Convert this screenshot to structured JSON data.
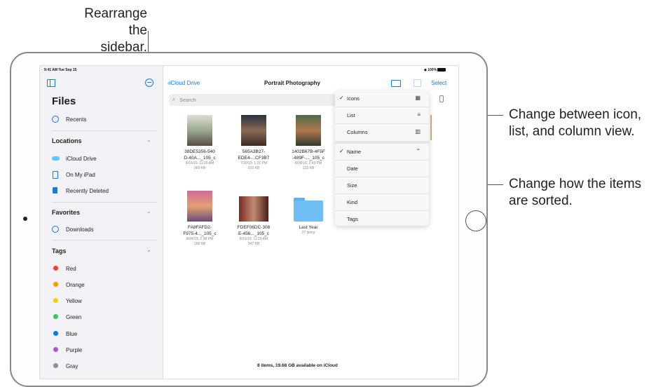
{
  "callouts": {
    "sidebar_line1": "Rearrange the",
    "sidebar_line2": "sidebar.",
    "view_line1": "Change between icon,",
    "view_line2": "list, and column view.",
    "sort_line1": "Change how the items",
    "sort_line2": "are sorted."
  },
  "status": {
    "time": "9:41 AM  Tue Sep 15",
    "battery": "100%"
  },
  "sidebar": {
    "title": "Files",
    "recents": "Recents",
    "locations": {
      "title": "Locations",
      "items": [
        "iCloud Drive",
        "On My iPad",
        "Recently Deleted"
      ]
    },
    "favorites": {
      "title": "Favorites",
      "items": [
        "Downloads"
      ]
    },
    "tags": {
      "title": "Tags",
      "items": [
        {
          "label": "Red",
          "color": "#ff3b30"
        },
        {
          "label": "Orange",
          "color": "#ff9500"
        },
        {
          "label": "Yellow",
          "color": "#ffcc00"
        },
        {
          "label": "Green",
          "color": "#34c759"
        },
        {
          "label": "Blue",
          "color": "#007aff"
        },
        {
          "label": "Purple",
          "color": "#af52de"
        },
        {
          "label": "Gray",
          "color": "#8e8e93"
        }
      ]
    }
  },
  "nav": {
    "back": "iCloud Drive",
    "title": "Portrait Photography",
    "select": "Select"
  },
  "search": {
    "placeholder": "Search"
  },
  "files": [
    {
      "name1": "38DE5356-540",
      "name2": "D-40A..._105_c",
      "date": "8/16/19, 11:26 AM",
      "size": "363 KB"
    },
    {
      "name1": "565A3B27-",
      "name2": "EDE4-...CF3B7",
      "date": "7/30/19, 1:21 PM",
      "size": "915 KB"
    },
    {
      "name1": "1402B67B-4F5F",
      "name2": "-489F-..._105_c",
      "date": "8/24/19, 2:43 PM",
      "size": "123 KB"
    },
    {
      "name1": "FA8FAFD2-",
      "name2": "F975-4..._105_c",
      "date": "8/24/19, 2:38 PM",
      "size": "168 KB"
    },
    {
      "name1": "FDEF06DC-308",
      "name2": "E-456..._105_c",
      "date": "8/16/19, 11:29 AM",
      "size": "347 KB"
    },
    {
      "name1": "Last Year",
      "name2": "",
      "date": "27 items",
      "size": ""
    }
  ],
  "menu": {
    "view": [
      "Icons",
      "List",
      "Columns"
    ],
    "sort": [
      "Name",
      "Date",
      "Size",
      "Kind",
      "Tags"
    ]
  },
  "footer": "8 items, 19.68 GB available on iCloud",
  "colors": {
    "accent": "#0a7aff",
    "sidebar_bg": "#f2f2f7",
    "folder": "#6fbff5"
  }
}
